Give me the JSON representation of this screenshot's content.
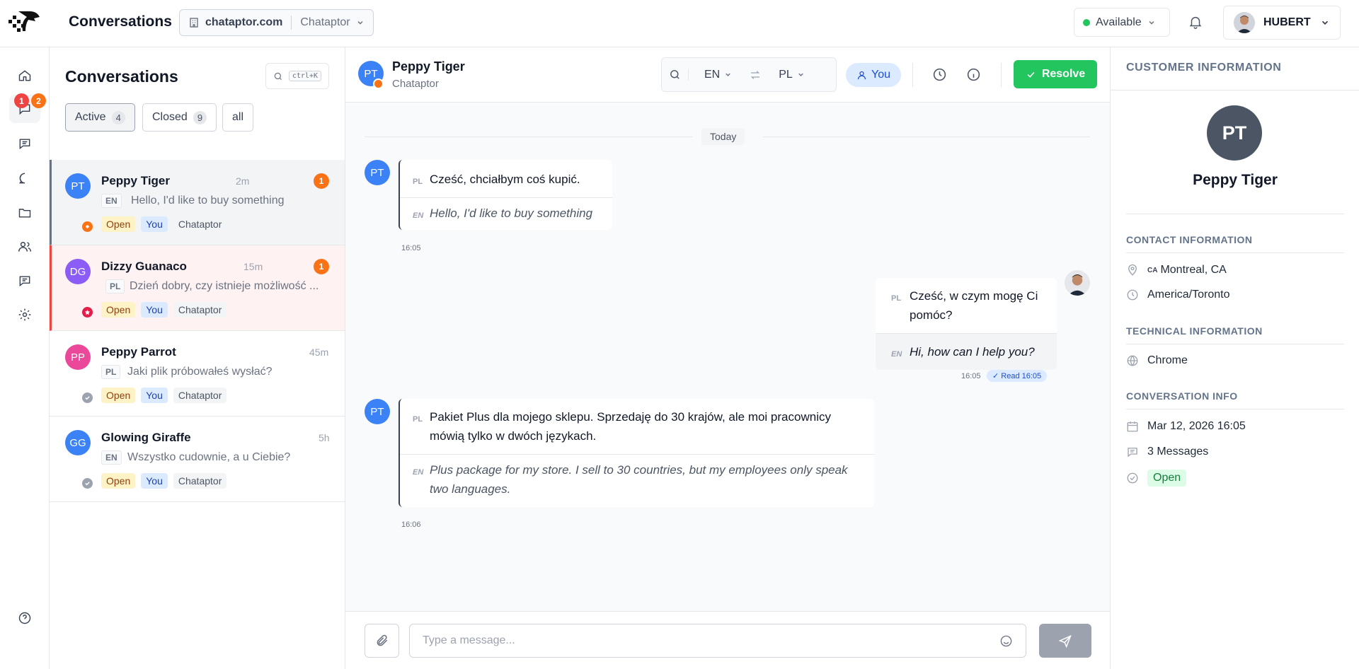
{
  "topbar": {
    "title": "Conversations",
    "workspace_domain": "chataptor.com",
    "workspace_org": "Chataptor",
    "status_label": "Available",
    "user_name": "HUBERT"
  },
  "rail": {
    "badge_red": "1",
    "badge_orange": "2"
  },
  "list": {
    "title": "Conversations",
    "search_shortcut": "ctrl+K",
    "filters": [
      {
        "label": "Active",
        "count": "4"
      },
      {
        "label": "Closed",
        "count": "9"
      },
      {
        "label": "all"
      }
    ],
    "items": [
      {
        "initials": "PT",
        "name": "Peppy Tiger",
        "time": "2m",
        "unread": "1",
        "lang": "EN",
        "preview": "Hello, I'd like to buy something",
        "tags": [
          "Open",
          "You",
          "Chataptor"
        ],
        "color": "#3b82f6"
      },
      {
        "initials": "DG",
        "name": "Dizzy Guanaco",
        "time": "15m",
        "unread": "1",
        "lang": "PL",
        "preview": "Dzień dobry, czy istnieje możliwość ...",
        "tags": [
          "Open",
          "You",
          "Chataptor"
        ],
        "color": "#8b5cf6"
      },
      {
        "initials": "PP",
        "name": "Peppy Parrot",
        "time": "45m",
        "lang": "PL",
        "preview": "Jaki plik próbowałeś wysłać?",
        "tags": [
          "Open",
          "You",
          "Chataptor"
        ],
        "color": "#ec4899"
      },
      {
        "initials": "GG",
        "name": "Glowing Giraffe",
        "time": "5h",
        "lang": "EN",
        "preview": "Wszystko cudownie, a u Ciebie?",
        "tags": [
          "Open",
          "You",
          "Chataptor"
        ],
        "color": "#3b82f6"
      }
    ]
  },
  "chat": {
    "contact_initials": "PT",
    "contact_name": "Peppy Tiger",
    "contact_org": "Chataptor",
    "lang_from": "EN",
    "lang_to": "PL",
    "assignee": "You",
    "resolve_label": "Resolve",
    "date_divider": "Today",
    "messages": [
      {
        "dir": "in",
        "orig_lang": "PL",
        "orig": "Cześć, chciałbym coś kupić.",
        "tr_lang": "EN",
        "tr": "Hello, I'd like to buy something",
        "time": "16:05"
      },
      {
        "dir": "out",
        "orig_lang": "PL",
        "orig": "Cześć, w czym mogę Ci pomóc?",
        "tr_lang": "EN",
        "tr": "Hi, how can I help you?",
        "time": "16:05",
        "read": "Read",
        "read_time": "16:05"
      },
      {
        "dir": "in",
        "orig_lang": "PL",
        "orig": "Pakiet Plus dla mojego sklepu. Sprzedaję do 30 krajów, ale moi pracownicy mówią tylko w dwóch językach.",
        "tr_lang": "EN",
        "tr": "Plus package for my store. I sell to 30 countries, but my employees only speak two languages.",
        "time": "16:06"
      }
    ],
    "composer_placeholder": "Type a message..."
  },
  "info": {
    "title": "CUSTOMER INFORMATION",
    "initials": "PT",
    "name": "Peppy Tiger",
    "contact_header": "CONTACT INFORMATION",
    "country_code": "CA",
    "location": "Montreal, CA",
    "timezone": "America/Toronto",
    "tech_header": "TECHNICAL INFORMATION",
    "browser": "Chrome",
    "conv_header": "CONVERSATION INFO",
    "created": "Mar 12, 2026 16:05",
    "messages_count": "3 Messages",
    "status": "Open"
  },
  "colors": {
    "accent_green": "#22c55e",
    "badge_orange": "#f97316",
    "badge_red": "#ef4444",
    "avatar_blue": "#3b82f6"
  }
}
